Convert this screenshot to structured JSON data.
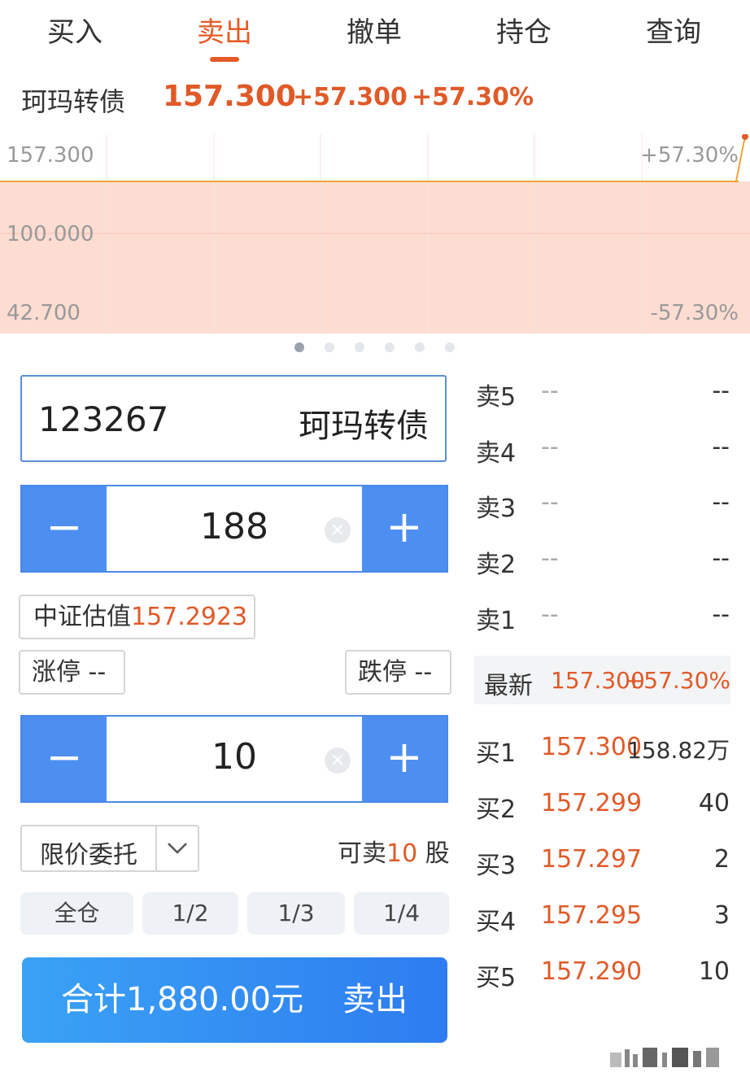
{
  "tabs": [
    {
      "label": "买入"
    },
    {
      "label": "卖出"
    },
    {
      "label": "撤单"
    },
    {
      "label": "持仓"
    },
    {
      "label": "查询"
    }
  ],
  "active_tab": "卖出",
  "quote": {
    "name": "珂玛转债",
    "price": "157.300",
    "change": "+57.300",
    "change_pct": "+57.30%"
  },
  "chart": {
    "y_max_label": "157.300",
    "y_mid_label": "100.000",
    "y_min_label": "42.700",
    "pct_max_label": "+57.30%",
    "pct_min_label": "-57.30%",
    "pager_count": 6,
    "pager_active": 0,
    "colors": {
      "line": "#f2a33a",
      "fill": "#fddcd2",
      "grid": "#f7c2b4"
    }
  },
  "chart_data": {
    "type": "line",
    "ylim": [
      42.7,
      157.3
    ],
    "y_ticks": [
      "157.300",
      "100.000",
      "42.700"
    ],
    "right_ticks": [
      "+57.30%",
      "-57.30%"
    ],
    "series": [
      {
        "values": [
          157.3
        ]
      }
    ]
  },
  "order": {
    "code": "123267",
    "name": "珂玛转债",
    "price": "188",
    "minus_symbol": "−",
    "plus_symbol": "+",
    "clear_symbol": "×",
    "valuation_label": "中证估值",
    "valuation_value": "157.2923",
    "limit_up_label": "涨停",
    "limit_up_value": "--",
    "limit_down_label": "跌停",
    "limit_down_value": "--",
    "quantity": "10",
    "order_type": "限价委托",
    "sellable_prefix": "可卖",
    "sellable_value": "10",
    "sellable_suffix": "股",
    "fractions": [
      "全仓",
      "1/2",
      "1/3",
      "1/4"
    ],
    "total_label": "合计1,880.00元",
    "sell_label": "卖出"
  },
  "orderbook": {
    "asks": [
      {
        "label": "卖5",
        "price": "--",
        "vol": "--"
      },
      {
        "label": "卖4",
        "price": "--",
        "vol": "--"
      },
      {
        "label": "卖3",
        "price": "--",
        "vol": "--"
      },
      {
        "label": "卖2",
        "price": "--",
        "vol": "--"
      },
      {
        "label": "卖1",
        "price": "--",
        "vol": "--"
      }
    ],
    "latest_label": "最新",
    "latest_price": "157.300",
    "latest_pct": "+57.30%",
    "bids": [
      {
        "label": "买1",
        "price": "157.300",
        "vol": "158.82万"
      },
      {
        "label": "买2",
        "price": "157.299",
        "vol": "40"
      },
      {
        "label": "买3",
        "price": "157.297",
        "vol": "2"
      },
      {
        "label": "买4",
        "price": "157.295",
        "vol": "3"
      },
      {
        "label": "买5",
        "price": "157.290",
        "vol": "10"
      }
    ]
  },
  "colors": {
    "accent": "#e55a26",
    "blue": "#4d8ff0"
  }
}
